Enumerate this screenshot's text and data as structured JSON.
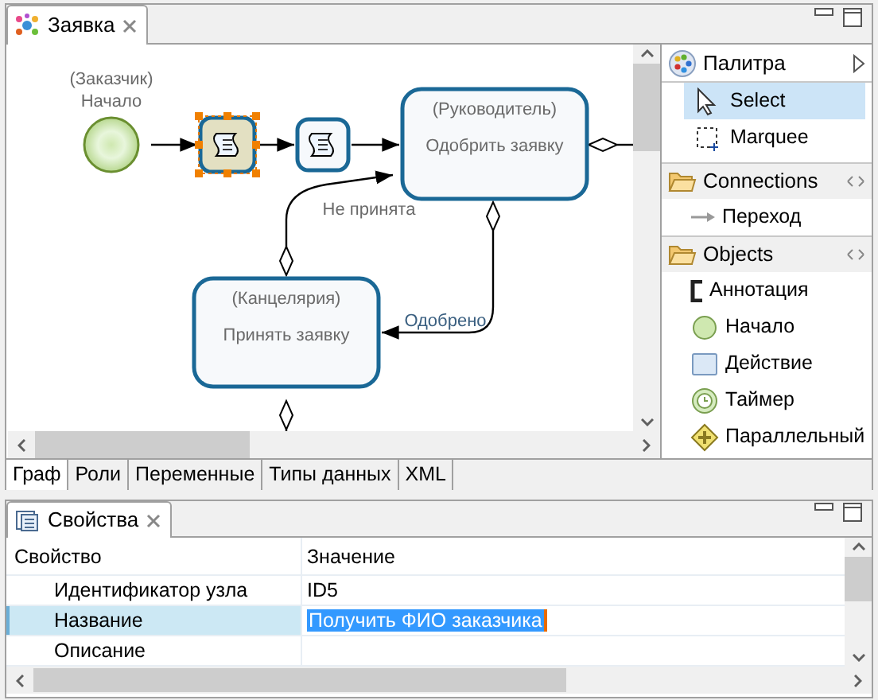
{
  "editor_tab": {
    "title": "Заявка"
  },
  "diagram": {
    "nodes": [
      {
        "kind": "start",
        "role": "(Заказчик)",
        "label": "Начало"
      },
      {
        "kind": "script",
        "selected": true
      },
      {
        "kind": "script",
        "selected": false
      },
      {
        "kind": "task",
        "role": "(Руководитель)",
        "label": "Одобрить заявку"
      },
      {
        "kind": "task",
        "role": "(Канцелярия)",
        "label": "Принять заявку"
      }
    ],
    "edge_labels": [
      "Не принята",
      "Одобрено"
    ]
  },
  "palette": {
    "title": "Палитра",
    "tools": [
      {
        "label": "Select",
        "kind": "select",
        "selected": true
      },
      {
        "label": "Marquee",
        "kind": "marquee",
        "selected": false
      }
    ],
    "drawers": [
      {
        "title": "Connections",
        "items": [
          {
            "label": "Переход",
            "kind": "transition"
          }
        ]
      },
      {
        "title": "Objects",
        "items": [
          {
            "label": "Аннотация",
            "kind": "annotation"
          },
          {
            "label": "Начало",
            "kind": "start"
          },
          {
            "label": "Действие",
            "kind": "action"
          },
          {
            "label": "Таймер",
            "kind": "timer"
          },
          {
            "label": "Параллельный",
            "kind": "parallel"
          }
        ]
      }
    ]
  },
  "bottom_tabs": [
    {
      "label": "Граф",
      "selected": true
    },
    {
      "label": "Роли",
      "selected": false
    },
    {
      "label": "Переменные",
      "selected": false
    },
    {
      "label": "Типы данных",
      "selected": false
    },
    {
      "label": "XML",
      "selected": false
    }
  ],
  "properties": {
    "tab": "Свойства",
    "columns": [
      "Свойство",
      "Значение"
    ],
    "rows": [
      {
        "name": "Идентификатор узла",
        "value": "ID5",
        "selected": false
      },
      {
        "name": "Название",
        "value": "Получить ФИО заказчика",
        "selected": true
      },
      {
        "name": "Описание",
        "selected": false
      }
    ]
  }
}
